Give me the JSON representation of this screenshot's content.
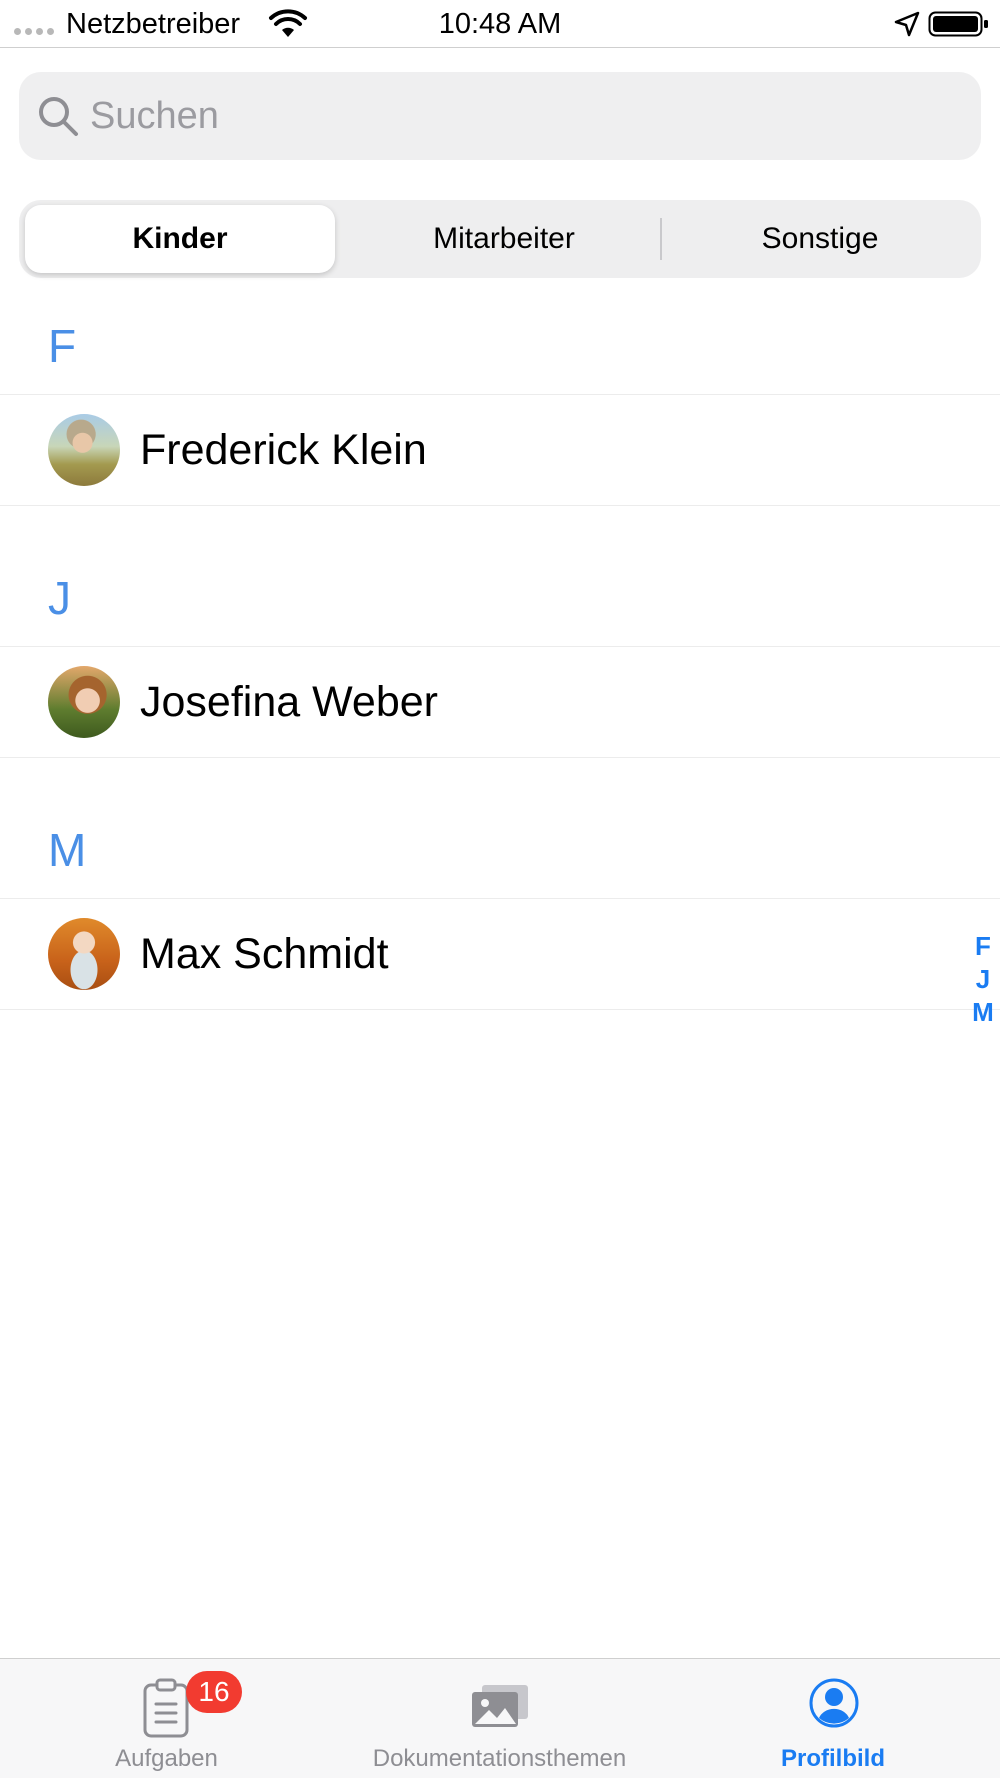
{
  "status_bar": {
    "carrier": "Netzbetreiber",
    "time": "10:48 AM",
    "icons": [
      "signal-dots-icon",
      "wifi-icon",
      "location-arrow-icon",
      "battery-icon"
    ]
  },
  "search": {
    "placeholder": "Suchen",
    "value": "",
    "icon": "search-icon"
  },
  "segments": {
    "selected": "Kinder",
    "items": [
      {
        "label": "Kinder"
      },
      {
        "label": "Mitarbeiter"
      },
      {
        "label": "Sonstige"
      }
    ]
  },
  "sections": [
    {
      "letter": "F",
      "items": [
        {
          "name": "Frederick Klein",
          "avatar": "avatar-photo"
        }
      ]
    },
    {
      "letter": "J",
      "items": [
        {
          "name": "Josefina Weber",
          "avatar": "avatar-photo"
        }
      ]
    },
    {
      "letter": "M",
      "items": [
        {
          "name": "Max Schmidt",
          "avatar": "avatar-photo"
        }
      ]
    }
  ],
  "index": [
    "F",
    "J",
    "M"
  ],
  "tab_bar": {
    "selected": "Profilbild",
    "tabs": [
      {
        "label": "Aufgaben",
        "icon": "clipboard-icon",
        "badge": "16"
      },
      {
        "label": "Dokumentationsthemen",
        "icon": "photos-icon"
      },
      {
        "label": "Profilbild",
        "icon": "profile-icon"
      }
    ]
  },
  "colors": {
    "accent": "#1a7cf2",
    "section_header": "#4a8fe6",
    "badge": "#f23b30",
    "inactive_tab": "#8e8e93"
  }
}
